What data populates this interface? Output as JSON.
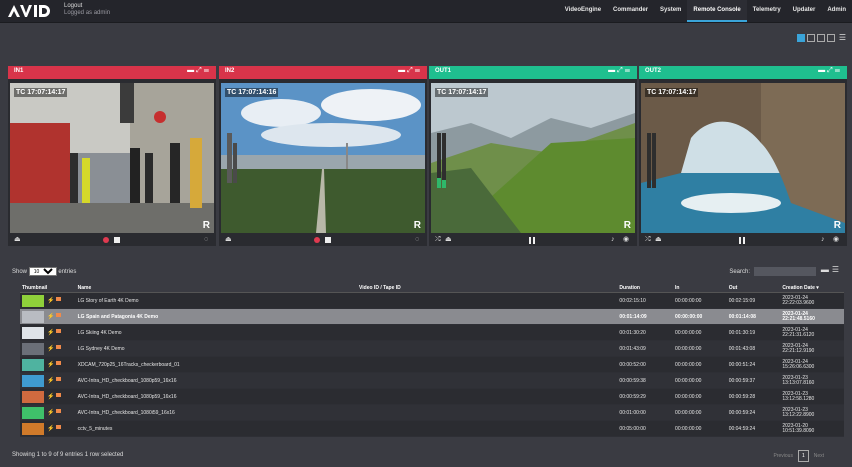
{
  "header": {
    "logo_text": "AVID",
    "logout_label": "Logout",
    "logged_as": "Logged as admin",
    "nav": [
      {
        "label": "VideoEngine",
        "active": false
      },
      {
        "label": "Commander",
        "active": false
      },
      {
        "label": "System",
        "active": false
      },
      {
        "label": "Remote Console",
        "active": true
      },
      {
        "label": "Telemetry",
        "active": false
      },
      {
        "label": "Updater",
        "active": false
      },
      {
        "label": "Admin",
        "active": false
      }
    ]
  },
  "panels": [
    {
      "title": "IN1",
      "kind": "in",
      "timecode": "TC 17:07:14:17",
      "r_badge": "R"
    },
    {
      "title": "IN2",
      "kind": "in",
      "timecode": "TC 17:07:14:16",
      "r_badge": "R"
    },
    {
      "title": "OUT1",
      "kind": "out",
      "timecode": "TC 17:07:14:17",
      "r_badge": "R"
    },
    {
      "title": "OUT2",
      "kind": "out",
      "timecode": "TC 17:07:14:17",
      "r_badge": "R"
    }
  ],
  "table": {
    "show_label": "Show",
    "entries_value": "10",
    "entries_label": "entries",
    "search_label": "Search:",
    "columns": {
      "thumbnail": "Thumbnail",
      "name": "Name",
      "video_id": "Video ID / Tape ID",
      "duration": "Duration",
      "in": "In",
      "out": "Out",
      "creation_date": "Creation Date"
    },
    "rows": [
      {
        "name": "LG Story of Earth 4K Demo",
        "duration": "00:02:15:10",
        "in": "00:00:00:00",
        "out": "00:02:15:09",
        "date": "2023-01-24",
        "time": "22:22:03.9600",
        "thumb": "#8fd03a",
        "selected": false
      },
      {
        "name": "LG Spain and Patagonia 4K Demo",
        "duration": "00:01:14:09",
        "in": "00:00:00:00",
        "out": "00:01:14:08",
        "date": "2023-01-24",
        "time": "22:21:48.5160",
        "thumb": "#b9bcc2",
        "selected": true
      },
      {
        "name": "LG Skiing 4K Demo",
        "duration": "00:01:30:20",
        "in": "00:00:00:00",
        "out": "00:01:30:19",
        "date": "2023-01-24",
        "time": "22:21:31.6120",
        "thumb": "#dfe3e8",
        "selected": false
      },
      {
        "name": "LG Sydney 4K Demo",
        "duration": "00:01:43:09",
        "in": "00:00:00:00",
        "out": "00:01:43:08",
        "date": "2023-01-24",
        "time": "22:21:12.9190",
        "thumb": "#6b6f78",
        "selected": false
      },
      {
        "name": "XDCAM_720p25_16Tracks_checkerboard_01",
        "duration": "00:00:52:00",
        "in": "00:00:00:00",
        "out": "00:00:51:24",
        "date": "2023-01-24",
        "time": "15:26:06.6300",
        "thumb": "#4fb3a0",
        "selected": false
      },
      {
        "name": "AVC-Intra_HD_checkboard_1080p59_16x16",
        "duration": "00:00:59:38",
        "in": "00:00:00:00",
        "out": "00:00:59:37",
        "date": "2023-01-23",
        "time": "13:13:07.8160",
        "thumb": "#3f9bd0",
        "selected": false
      },
      {
        "name": "AVC-Intra_HD_checkboard_1080p59_16x16",
        "duration": "00:00:59:29",
        "in": "00:00:00:00",
        "out": "00:00:59:28",
        "date": "2023-01-23",
        "time": "13:12:58.1280",
        "thumb": "#d06a3f",
        "selected": false
      },
      {
        "name": "AVC-Intra_HD_checkboard_1080i59_16x16",
        "duration": "00:01:00:00",
        "in": "00:00:00:00",
        "out": "00:00:59:24",
        "date": "2023-01-23",
        "time": "13:12:22.8900",
        "thumb": "#3fc06a",
        "selected": false
      },
      {
        "name": "cctv_5_minutes",
        "duration": "00:05:00:00",
        "in": "00:00:00:00",
        "out": "00:04:59:24",
        "date": "2023-01-20",
        "time": "10:51:39.8090",
        "thumb": "#d07a2a",
        "selected": false
      }
    ],
    "status": "Showing 1 to 9 of 9 entries    1 row selected",
    "pager": {
      "previous": "Previous",
      "page": "1",
      "next": "Next"
    }
  },
  "colors": {
    "in_header": "#d8344a",
    "out_header": "#1fbf8f",
    "accent": "#3aa4d9"
  }
}
